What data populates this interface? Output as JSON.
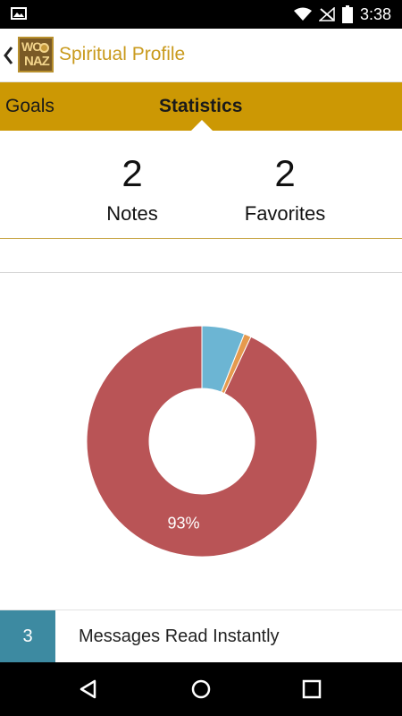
{
  "status_bar": {
    "time": "3:38",
    "icons": [
      "image-notification-icon",
      "wifi-icon",
      "no-signal-icon",
      "battery-icon"
    ]
  },
  "app_bar": {
    "title": "Spiritual Profile",
    "logo_line_1": "WO",
    "logo_line_2": "NAZ",
    "back_icon": "chevron-left-icon"
  },
  "tabs": [
    {
      "label": "Goals",
      "selected": false
    },
    {
      "label": "Statistics",
      "selected": true
    }
  ],
  "stats": {
    "notes": {
      "value": "2",
      "label": "Notes"
    },
    "favorites": {
      "value": "2",
      "label": "Favorites"
    }
  },
  "chart_data": {
    "type": "pie",
    "donut": true,
    "slices": [
      {
        "value": 6,
        "color": "#6cb5d3"
      },
      {
        "value": 1,
        "color": "#e59a4e"
      },
      {
        "value": 93,
        "color": "#b95456"
      }
    ],
    "data_labels": [
      "",
      "",
      "93%"
    ],
    "start_angle_deg": 0
  },
  "messages": {
    "count": "3",
    "label": "Messages Read Instantly"
  },
  "nav_bar": {
    "buttons": [
      "back-triangle-icon",
      "home-circle-icon",
      "recents-square-icon"
    ]
  },
  "colors": {
    "accent_gold": "#cc9804",
    "title_gold": "#c99a1d",
    "count_teal": "#3d8aa1"
  }
}
